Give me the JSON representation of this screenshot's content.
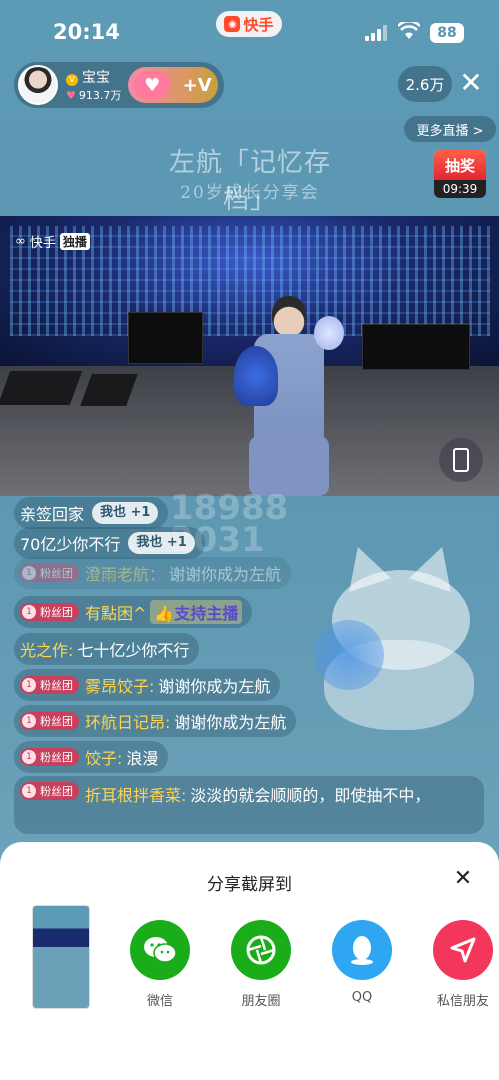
{
  "status_bar": {
    "time": "20:14",
    "battery": "88"
  },
  "app_badge": {
    "name": "快手"
  },
  "host": {
    "name": "宝宝",
    "likes": "913.7万",
    "follow_symbol": "+V"
  },
  "viewers": "2.6万",
  "close_symbol": "✕",
  "more_live": "更多直播 >",
  "stream_title": {
    "line1": "左航「记忆存档」",
    "line2": "20岁成长分享会"
  },
  "lottery": {
    "label": "抽奖",
    "timer": "09:39"
  },
  "video": {
    "logo": "快手",
    "exclusive": "独播"
  },
  "watermark": {
    "line1": "18988",
    "line2": "2031"
  },
  "chat": [
    {
      "text": "亲签回家",
      "metoo": "我也 +1"
    },
    {
      "text": "70亿少你不行",
      "metoo": "我也 +1"
    },
    {
      "badge": "粉丝团",
      "level": "1",
      "user": "澄雨老航：",
      "msg": "谢谢你成为左航"
    },
    {
      "badge": "粉丝团",
      "level": "1",
      "user": "有點困^",
      "msg": "👍支持主播"
    },
    {
      "user": "光之作:",
      "msg": "七十亿少你不行"
    },
    {
      "badge": "粉丝团",
      "level": "1",
      "user": "雾昂饺子:",
      "msg": "谢谢你成为左航"
    },
    {
      "badge": "粉丝团",
      "level": "1",
      "user": "环航日记昂:",
      "msg": "谢谢你成为左航"
    },
    {
      "badge": "粉丝团",
      "level": "1",
      "user": "饺子:",
      "msg": "浪漫"
    },
    {
      "badge": "粉丝团",
      "level": "1",
      "user": "折耳根拌香菜:",
      "msg": "淡淡的就会顺顺的，即使抽不中，"
    }
  ],
  "share_sheet": {
    "title": "分享截屏到",
    "close": "✕",
    "options": [
      {
        "label": "微信",
        "color": "#1aad19"
      },
      {
        "label": "朋友圈",
        "color": "#1aad19"
      },
      {
        "label": "QQ",
        "color": "#2fa6f2"
      },
      {
        "label": "私信朋友",
        "color": "#f2375a"
      }
    ]
  }
}
